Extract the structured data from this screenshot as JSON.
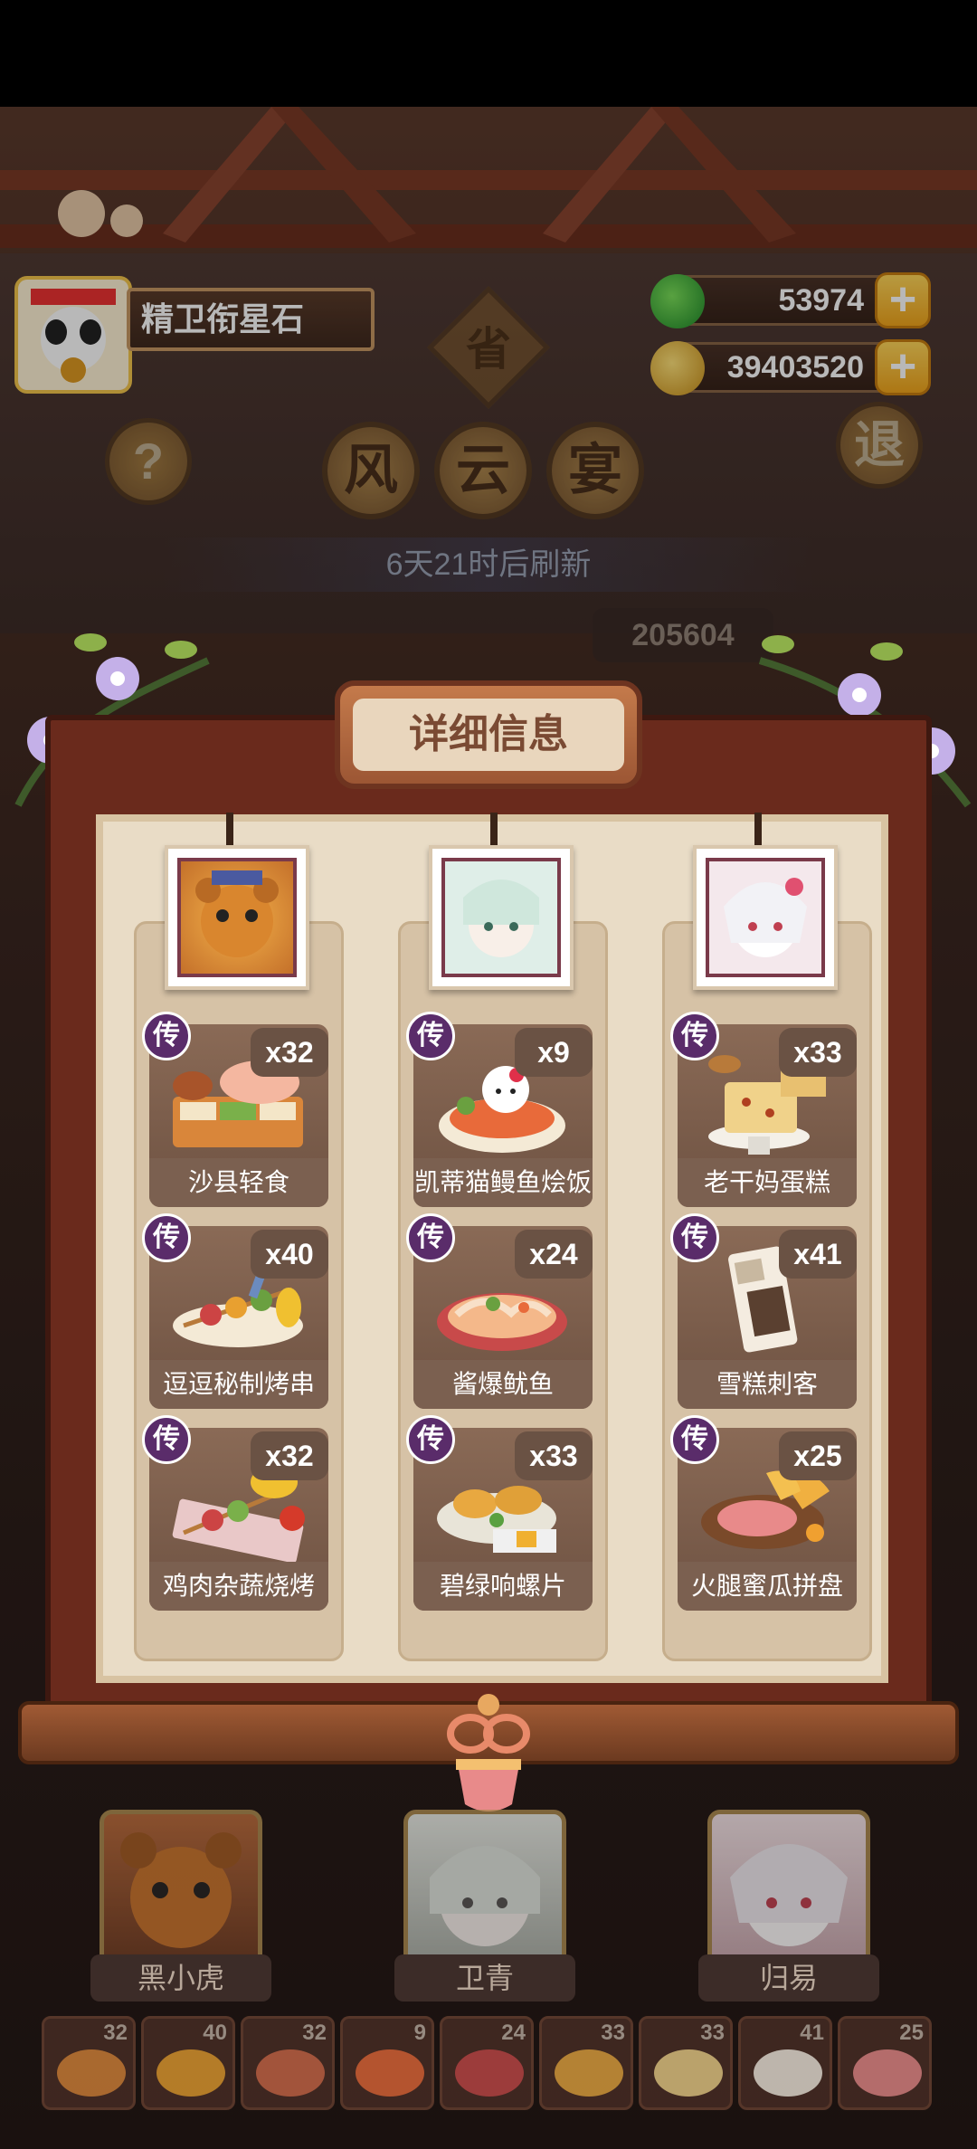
{
  "player": {
    "name": "精卫衔星石"
  },
  "currencies": {
    "jade": "53974",
    "coins": "39403520",
    "plus": "+"
  },
  "buttons": {
    "help": "?",
    "exit": "退"
  },
  "event": {
    "province": "省",
    "title_chars": [
      "风",
      "云",
      "宴"
    ],
    "refresh": "6天21时后刷新",
    "score": "205604"
  },
  "panel": {
    "title": "详细信息",
    "badge": "传",
    "columns": [
      {
        "dishes": [
          {
            "name": "沙县轻食",
            "count": "x32"
          },
          {
            "name": "逗逗秘制烤串",
            "count": "x40"
          },
          {
            "name": "鸡肉杂蔬烧烤",
            "count": "x32"
          }
        ]
      },
      {
        "dishes": [
          {
            "name": "凯蒂猫鳗鱼烩饭",
            "count": "x9"
          },
          {
            "name": "酱爆鱿鱼",
            "count": "x24"
          },
          {
            "name": "碧绿响螺片",
            "count": "x33"
          }
        ]
      },
      {
        "dishes": [
          {
            "name": "老干妈蛋糕",
            "count": "x33"
          },
          {
            "name": "雪糕刺客",
            "count": "x41"
          },
          {
            "name": "火腿蜜瓜拼盘",
            "count": "x25"
          }
        ]
      }
    ]
  },
  "heroes": [
    {
      "name": "黑小虎"
    },
    {
      "name": "卫青"
    },
    {
      "name": "归易"
    }
  ],
  "strip": [
    "32",
    "40",
    "32",
    "9",
    "24",
    "33",
    "33",
    "41",
    "25"
  ],
  "colors": {
    "panel_red": "#6a2a1c",
    "parchment": "#e9dcc6",
    "badge_purple": "#5a2c6a",
    "gold": "#f0a51c"
  }
}
